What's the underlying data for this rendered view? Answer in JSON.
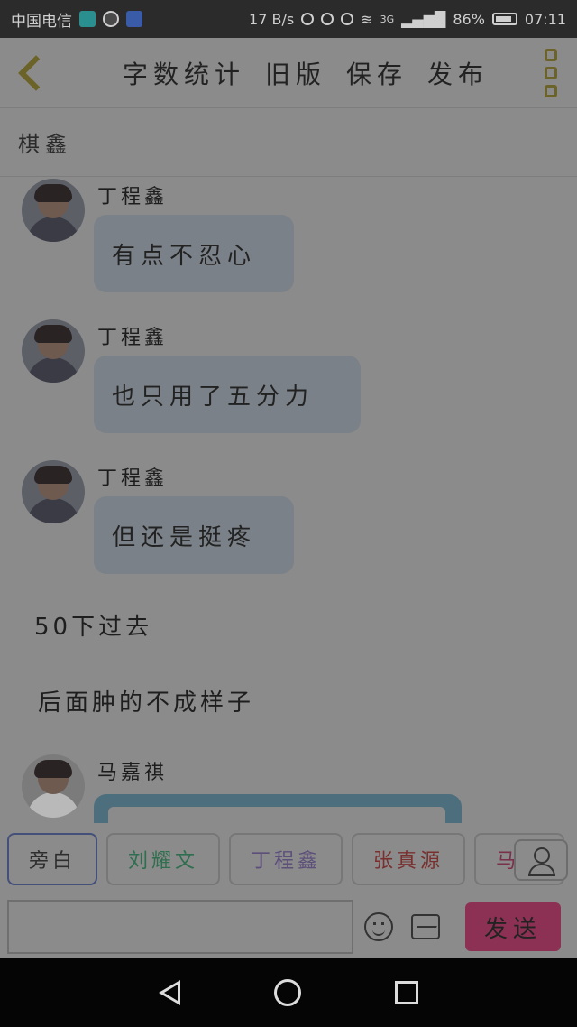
{
  "status": {
    "carrier": "中国电信",
    "speed": "17 B/s",
    "network": "3G",
    "battery": "86%",
    "time": "07:11"
  },
  "topbar": {
    "actions": [
      "字数统计",
      "旧版",
      "保存",
      "发布"
    ]
  },
  "title": "棋鑫",
  "messages": [
    {
      "sender": "丁程鑫",
      "text": "有点不忍心"
    },
    {
      "sender": "丁程鑫",
      "text": "也只用了五分力"
    },
    {
      "sender": "丁程鑫",
      "text": "但还是挺疼"
    }
  ],
  "narration": [
    "50下过去",
    "后面肿的不成样子"
  ],
  "last_sender": "马嘉祺",
  "characters": [
    "旁白",
    "刘耀文",
    "丁程鑫",
    "张真源",
    "马嘉"
  ],
  "input": {
    "placeholder": "",
    "send_label": "发送"
  }
}
